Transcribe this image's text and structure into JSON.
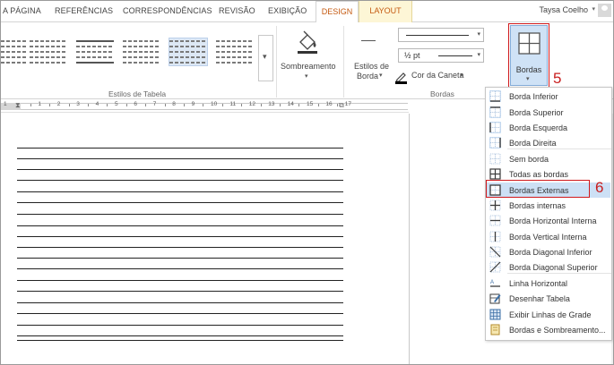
{
  "tabs": {
    "items": [
      {
        "label": "A PÁGINA"
      },
      {
        "label": "REFERÊNCIAS"
      },
      {
        "label": "CORRESPONDÊNCIAS"
      },
      {
        "label": "REVISÃO"
      },
      {
        "label": "EXIBIÇÃO"
      }
    ],
    "design": "DESIGN",
    "layout": "LAYOUT",
    "active": "DESIGN",
    "user": "Taysa Coelho"
  },
  "ribbon": {
    "table_styles_group": "Estilos de Tabela",
    "shading": "Sombreamento",
    "border_styles_line1": "Estilos de",
    "border_styles_line2": "Borda",
    "pen_weight": "½ pt",
    "pen_color": "Cor da Caneta",
    "borders_group": "Bordas",
    "borders_button": "Bordas",
    "step5": "5"
  },
  "ruler": {
    "numbers": [
      "1",
      "1",
      "2",
      "3",
      "4",
      "5",
      "6",
      "7",
      "8",
      "9",
      "10",
      "11",
      "12",
      "13",
      "14",
      "15",
      "16",
      "17"
    ]
  },
  "menu": {
    "items": [
      {
        "label": "Borda Inferior",
        "icon": "border-bottom-icon"
      },
      {
        "label": "Borda Superior",
        "icon": "border-top-icon"
      },
      {
        "label": "Borda Esquerda",
        "icon": "border-left-icon"
      },
      {
        "label": "Borda Direita",
        "icon": "border-right-icon"
      },
      {
        "label": "Sem borda",
        "icon": "no-border-icon"
      },
      {
        "label": "Todas as bordas",
        "icon": "all-borders-icon"
      },
      {
        "label": "Bordas Externas",
        "icon": "outside-borders-icon"
      },
      {
        "label": "Bordas internas",
        "icon": "inside-borders-icon"
      },
      {
        "label": "Borda Horizontal Interna",
        "icon": "inside-horizontal-border-icon"
      },
      {
        "label": "Borda Vertical Interna",
        "icon": "inside-vertical-border-icon"
      },
      {
        "label": "Borda Diagonal Inferior",
        "icon": "diagonal-down-border-icon"
      },
      {
        "label": "Borda Diagonal Superior",
        "icon": "diagonal-up-border-icon"
      },
      {
        "label": "Linha Horizontal",
        "icon": "horizontal-line-icon"
      },
      {
        "label": "Desenhar Tabela",
        "icon": "draw-table-icon"
      },
      {
        "label": "Exibir Linhas de Grade",
        "icon": "view-gridlines-icon"
      },
      {
        "label": "Bordas e Sombreamento...",
        "icon": "borders-shading-icon"
      }
    ],
    "selected": "Bordas Externas",
    "step6": "6"
  },
  "colors": {
    "accent_blue": "#cfe2f6",
    "selection_blue": "#cde0f5",
    "annotation_red": "#d0191c",
    "context_tab": "#c55a11"
  }
}
